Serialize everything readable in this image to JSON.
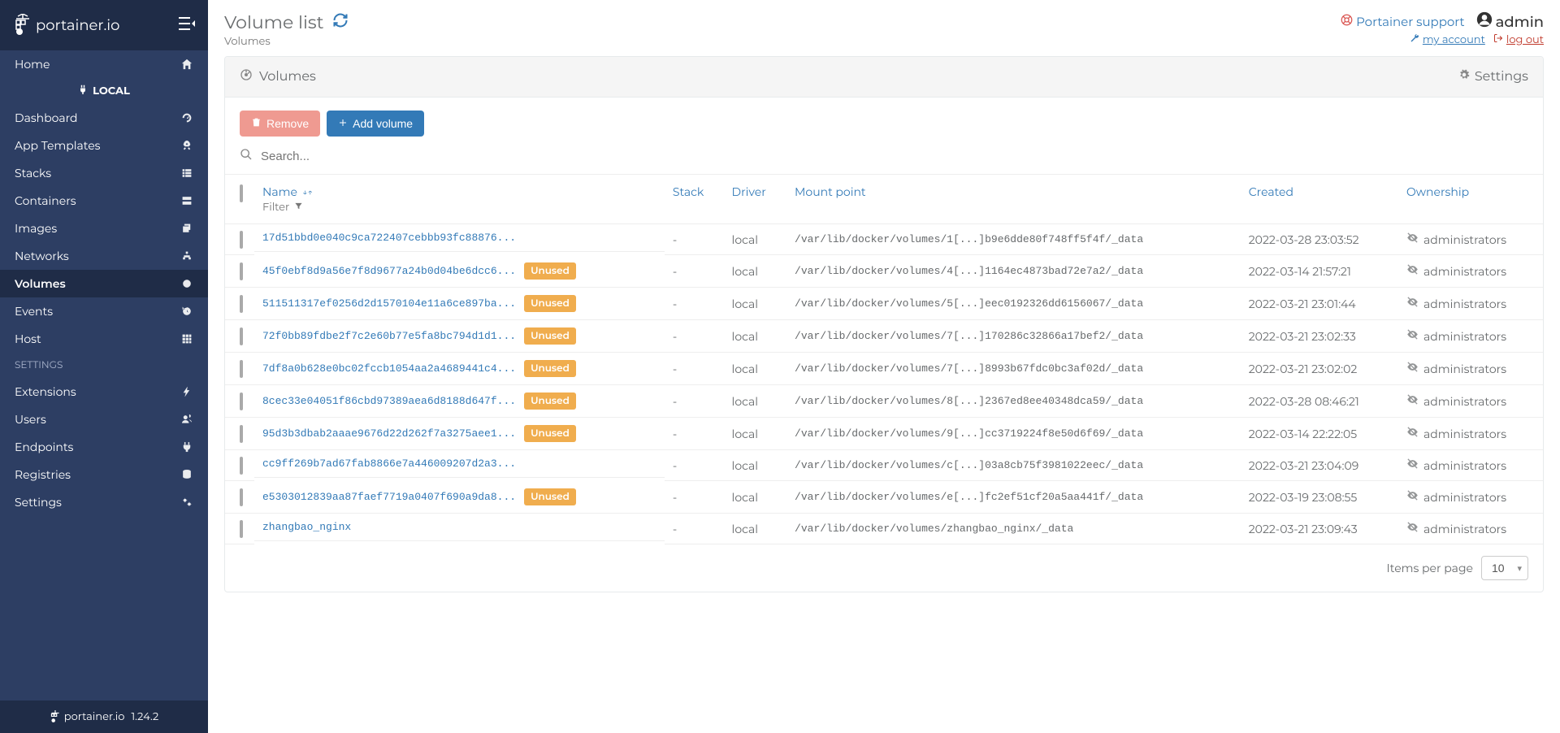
{
  "logo_text": "portainer.io",
  "version": "1.24.2",
  "sidebar": {
    "home": "Home",
    "section": "LOCAL",
    "items": [
      {
        "label": "Dashboard",
        "icon": "tachometer-icon"
      },
      {
        "label": "App Templates",
        "icon": "rocket-icon"
      },
      {
        "label": "Stacks",
        "icon": "th-list-icon"
      },
      {
        "label": "Containers",
        "icon": "server-icon"
      },
      {
        "label": "Images",
        "icon": "clone-icon"
      },
      {
        "label": "Networks",
        "icon": "sitemap-icon"
      },
      {
        "label": "Volumes",
        "icon": "hdd-icon",
        "active": true
      },
      {
        "label": "Events",
        "icon": "history-icon"
      },
      {
        "label": "Host",
        "icon": "th-icon"
      }
    ],
    "settings_label": "SETTINGS",
    "settings_items": [
      {
        "label": "Extensions",
        "icon": "bolt-icon"
      },
      {
        "label": "Users",
        "icon": "users-icon"
      },
      {
        "label": "Endpoints",
        "icon": "plug-icon"
      },
      {
        "label": "Registries",
        "icon": "database-icon"
      },
      {
        "label": "Settings",
        "icon": "cogs-icon"
      }
    ]
  },
  "header": {
    "title": "Volume list",
    "breadcrumb": "Volumes",
    "support": "Portainer support",
    "username": "admin",
    "my_account": "my account",
    "logout": "log out"
  },
  "panel": {
    "title": "Volumes",
    "settings": "Settings",
    "remove": "Remove",
    "add": "Add volume",
    "search_placeholder": "Search...",
    "columns": {
      "name": "Name",
      "filter": "Filter",
      "stack": "Stack",
      "driver": "Driver",
      "mount": "Mount point",
      "created": "Created",
      "ownership": "Ownership"
    },
    "unused_badge": "Unused",
    "items_per_page_label": "Items per page",
    "items_per_page_value": "10"
  },
  "rows": [
    {
      "name": "17d51bbd0e040c9ca722407cebbb93fc88876...",
      "unused": false,
      "stack": "-",
      "driver": "local",
      "mount": "/var/lib/docker/volumes/1[...]b9e6dde80f748ff5f4f/_data",
      "created": "2022-03-28 23:03:52",
      "ownership": "administrators"
    },
    {
      "name": "45f0ebf8d9a56e7f8d9677a24b0d04be6dcc6...",
      "unused": true,
      "stack": "-",
      "driver": "local",
      "mount": "/var/lib/docker/volumes/4[...]1164ec4873bad72e7a2/_data",
      "created": "2022-03-14 21:57:21",
      "ownership": "administrators"
    },
    {
      "name": "511511317ef0256d2d1570104e11a6ce897ba...",
      "unused": true,
      "stack": "-",
      "driver": "local",
      "mount": "/var/lib/docker/volumes/5[...]eec0192326dd6156067/_data",
      "created": "2022-03-21 23:01:44",
      "ownership": "administrators"
    },
    {
      "name": "72f0bb89fdbe2f7c2e60b77e5fa8bc794d1d1...",
      "unused": true,
      "stack": "-",
      "driver": "local",
      "mount": "/var/lib/docker/volumes/7[...]170286c32866a17bef2/_data",
      "created": "2022-03-21 23:02:33",
      "ownership": "administrators"
    },
    {
      "name": "7df8a0b628e0bc02fccb1054aa2a4689441c4...",
      "unused": true,
      "stack": "-",
      "driver": "local",
      "mount": "/var/lib/docker/volumes/7[...]8993b67fdc0bc3af02d/_data",
      "created": "2022-03-21 23:02:02",
      "ownership": "administrators"
    },
    {
      "name": "8cec33e04051f86cbd97389aea6d8188d647f...",
      "unused": true,
      "stack": "-",
      "driver": "local",
      "mount": "/var/lib/docker/volumes/8[...]2367ed8ee40348dca59/_data",
      "created": "2022-03-28 08:46:21",
      "ownership": "administrators"
    },
    {
      "name": "95d3b3dbab2aaae9676d22d262f7a3275aee1...",
      "unused": true,
      "stack": "-",
      "driver": "local",
      "mount": "/var/lib/docker/volumes/9[...]cc3719224f8e50d6f69/_data",
      "created": "2022-03-14 22:22:05",
      "ownership": "administrators"
    },
    {
      "name": "cc9ff269b7ad67fab8866e7a446009207d2a3...",
      "unused": false,
      "stack": "-",
      "driver": "local",
      "mount": "/var/lib/docker/volumes/c[...]03a8cb75f3981022eec/_data",
      "created": "2022-03-21 23:04:09",
      "ownership": "administrators"
    },
    {
      "name": "e5303012839aa87faef7719a0407f690a9da8...",
      "unused": true,
      "stack": "-",
      "driver": "local",
      "mount": "/var/lib/docker/volumes/e[...]fc2ef51cf20a5aa441f/_data",
      "created": "2022-03-19 23:08:55",
      "ownership": "administrators"
    },
    {
      "name": "zhangbao_nginx",
      "unused": false,
      "stack": "-",
      "driver": "local",
      "mount": "/var/lib/docker/volumes/zhangbao_nginx/_data",
      "created": "2022-03-21 23:09:43",
      "ownership": "administrators"
    }
  ]
}
